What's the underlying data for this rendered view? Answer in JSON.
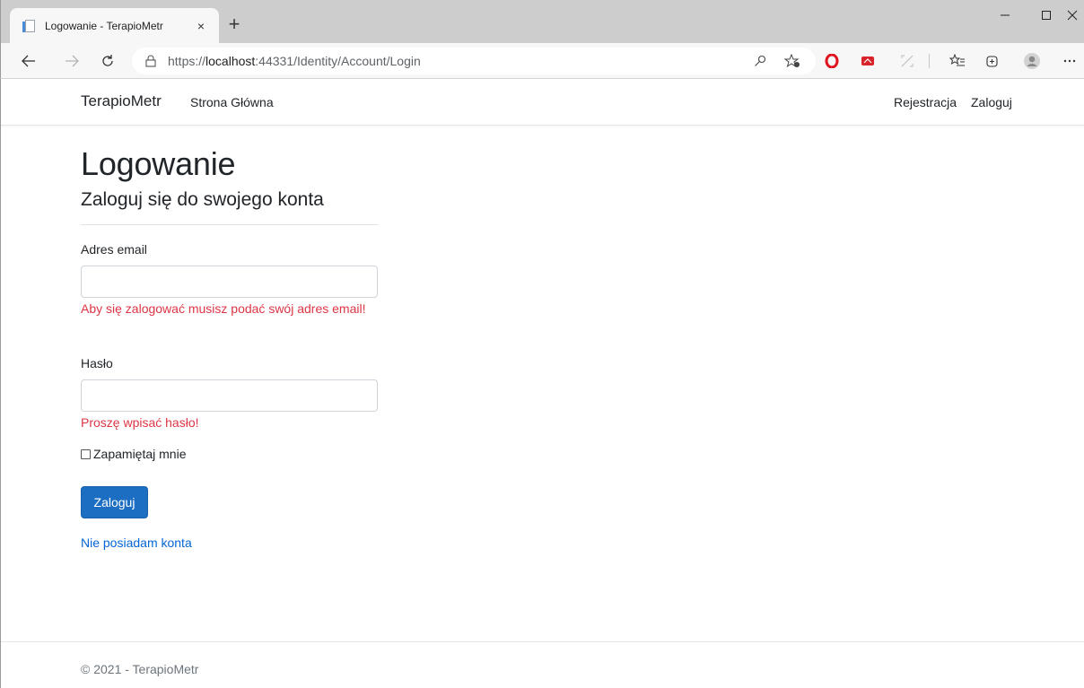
{
  "browser": {
    "tab_title": "Logowanie - TerapioMetr",
    "tab_close": "×",
    "new_tab": "+",
    "url_scheme": "https://",
    "url_host": "localhost",
    "url_rest": ":44331/Identity/Account/Login",
    "icons": [
      "back-icon",
      "forward-icon",
      "reload-icon",
      "lock-icon",
      "key-icon",
      "favorites-add-icon",
      "opera-icon",
      "extension-red-icon",
      "cast-icon",
      "favorites-icon",
      "collections-icon",
      "profile-icon",
      "more-icon"
    ]
  },
  "navbar": {
    "brand": "TerapioMetr",
    "home": "Strona Główna",
    "register": "Rejestracja",
    "login": "Zaloguj"
  },
  "main": {
    "title": "Logowanie",
    "subtitle": "Zaloguj się do swojego konta",
    "email_label": "Adres email",
    "email_value": "",
    "email_error": "Aby się zalogować musisz podać swój adres email!",
    "password_label": "Hasło",
    "password_value": "",
    "password_error": "Proszę wpisać hasło!",
    "remember_label": "Zapamiętaj mnie",
    "remember_checked": false,
    "submit_label": "Zaloguj",
    "no_account_link": "Nie posiadam konta"
  },
  "footer": {
    "text": "© 2021 - TerapioMetr"
  },
  "colors": {
    "primary": "#1b6ec2",
    "error": "#dc3545",
    "link": "#0366d6"
  }
}
